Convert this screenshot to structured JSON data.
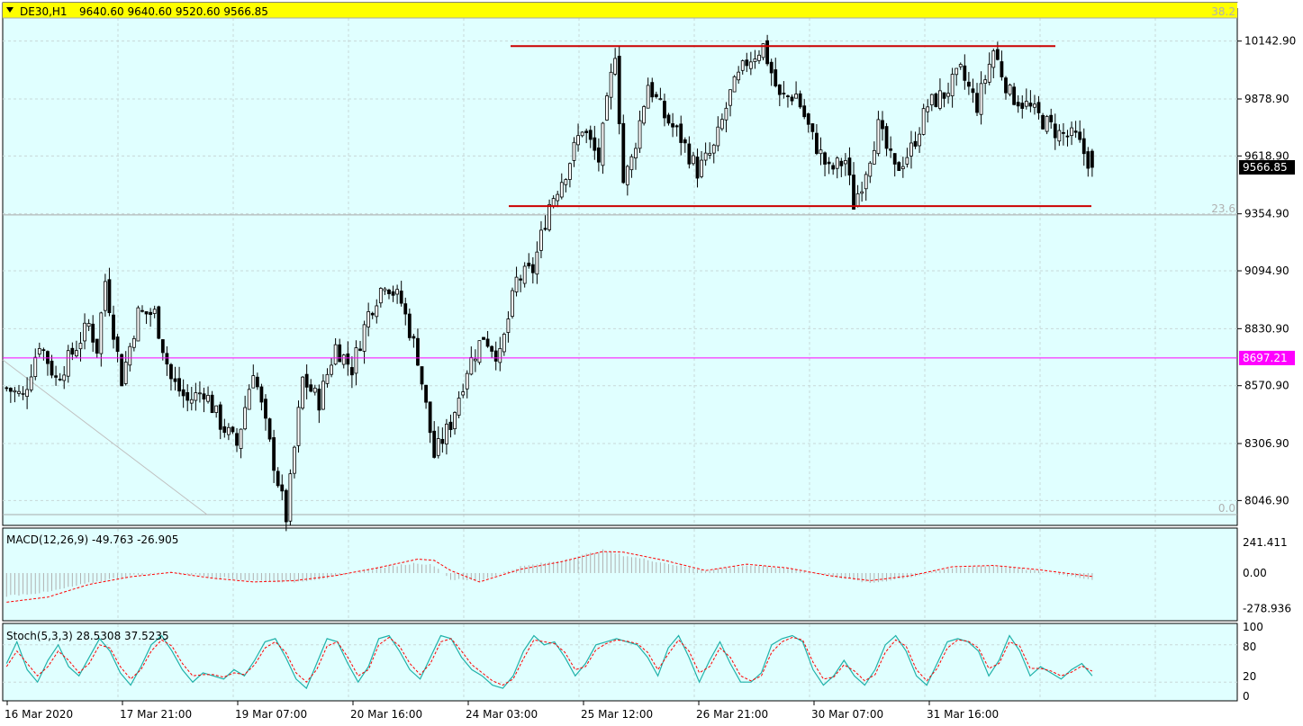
{
  "header": {
    "symbol": "DE30,H1",
    "ohlc": "9640.60 9640.60 9520.60 9566.85"
  },
  "price_axis_labels": [
    "10142.90",
    "9878.90",
    "9618.90",
    "9354.90",
    "9094.90",
    "8830.90",
    "8570.90",
    "8306.90",
    "8046.90"
  ],
  "current_price_tag": "9566.85",
  "horizontal_line_tag": "8697.21",
  "fib_labels": [
    "38.2",
    "23.6",
    "0.0"
  ],
  "macd": {
    "label": "MACD(12,26,9) -49.763 -26.905",
    "axis_labels": [
      "241.411",
      "0.00",
      "-278.936"
    ]
  },
  "stoch": {
    "label": "Stoch(5,3,3) 28.5308 37.5235",
    "axis_labels": [
      "100",
      "80",
      "20",
      "0"
    ]
  },
  "time_labels": [
    "16 Mar 2020",
    "17 Mar 21:00",
    "19 Mar 07:00",
    "20 Mar 16:00",
    "24 Mar 03:00",
    "25 Mar 12:00",
    "26 Mar 21:00",
    "30 Mar 07:00",
    "31 Mar 16:00"
  ],
  "colors": {
    "background": "#e0ffff",
    "header_bar": "#ffff00",
    "resistance_support": "#cc0000",
    "horizontal_line": "#ff00ff",
    "macd_signal": "#ff0000",
    "stoch_main": "#20b2aa",
    "stoch_signal": "#ff0000"
  },
  "chart_data": {
    "type": "candlestick",
    "symbol": "DE30",
    "timeframe": "H1",
    "ylim": [
      7950,
      10240
    ],
    "resistance_level": 10120,
    "support_level": 9390,
    "horizontal_level": 8697.21,
    "fib_levels": [
      {
        "label": "38.2",
        "price": 10240
      },
      {
        "label": "23.6",
        "price": 9350
      },
      {
        "label": "0.0",
        "price": 7950
      }
    ],
    "close_path": [
      [
        0,
        8560
      ],
      [
        4,
        8520
      ],
      [
        8,
        8770
      ],
      [
        12,
        8600
      ],
      [
        16,
        8720
      ],
      [
        20,
        8850
      ],
      [
        22,
        8740
      ],
      [
        24,
        9050
      ],
      [
        28,
        8600
      ],
      [
        32,
        8900
      ],
      [
        36,
        8900
      ],
      [
        40,
        8600
      ],
      [
        44,
        8500
      ],
      [
        48,
        8550
      ],
      [
        52,
        8400
      ],
      [
        56,
        8300
      ],
      [
        60,
        8650
      ],
      [
        64,
        8300
      ],
      [
        68,
        7970
      ],
      [
        72,
        8600
      ],
      [
        76,
        8500
      ],
      [
        80,
        8750
      ],
      [
        84,
        8650
      ],
      [
        88,
        8900
      ],
      [
        92,
        9050
      ],
      [
        96,
        8950
      ],
      [
        100,
        8700
      ],
      [
        104,
        8250
      ],
      [
        108,
        8400
      ],
      [
        112,
        8650
      ],
      [
        116,
        8800
      ],
      [
        120,
        8700
      ],
      [
        124,
        9050
      ],
      [
        128,
        9100
      ],
      [
        132,
        9400
      ],
      [
        136,
        9550
      ],
      [
        140,
        9750
      ],
      [
        144,
        9600
      ],
      [
        148,
        10100
      ],
      [
        150,
        9500
      ],
      [
        152,
        9600
      ],
      [
        156,
        9950
      ],
      [
        160,
        9800
      ],
      [
        164,
        9700
      ],
      [
        168,
        9550
      ],
      [
        172,
        9650
      ],
      [
        176,
        9900
      ],
      [
        180,
        10050
      ],
      [
        184,
        10120
      ],
      [
        188,
        9880
      ],
      [
        192,
        9900
      ],
      [
        196,
        9700
      ],
      [
        200,
        9550
      ],
      [
        204,
        9600
      ],
      [
        206,
        9400
      ],
      [
        208,
        9500
      ],
      [
        212,
        9750
      ],
      [
        216,
        9550
      ],
      [
        220,
        9650
      ],
      [
        224,
        9850
      ],
      [
        228,
        9900
      ],
      [
        232,
        10000
      ],
      [
        236,
        9850
      ],
      [
        240,
        10100
      ],
      [
        244,
        9900
      ],
      [
        248,
        9850
      ],
      [
        252,
        9780
      ],
      [
        256,
        9720
      ],
      [
        260,
        9700
      ],
      [
        264,
        9566.85
      ]
    ],
    "macd_hist_path": [
      [
        0,
        -180
      ],
      [
        10,
        -150
      ],
      [
        20,
        -80
      ],
      [
        30,
        -20
      ],
      [
        40,
        10
      ],
      [
        50,
        -30
      ],
      [
        60,
        -60
      ],
      [
        70,
        -70
      ],
      [
        80,
        -30
      ],
      [
        90,
        40
      ],
      [
        100,
        80
      ],
      [
        104,
        60
      ],
      [
        108,
        -50
      ],
      [
        115,
        -60
      ],
      [
        125,
        50
      ],
      [
        135,
        100
      ],
      [
        145,
        180
      ],
      [
        150,
        140
      ],
      [
        160,
        80
      ],
      [
        170,
        20
      ],
      [
        180,
        60
      ],
      [
        190,
        40
      ],
      [
        200,
        -20
      ],
      [
        210,
        -80
      ],
      [
        220,
        -30
      ],
      [
        230,
        40
      ],
      [
        240,
        60
      ],
      [
        250,
        20
      ],
      [
        264,
        -50
      ]
    ],
    "macd_signal_path": [
      [
        0,
        -230
      ],
      [
        10,
        -190
      ],
      [
        20,
        -90
      ],
      [
        30,
        -30
      ],
      [
        40,
        5
      ],
      [
        50,
        -40
      ],
      [
        60,
        -70
      ],
      [
        70,
        -60
      ],
      [
        80,
        -20
      ],
      [
        90,
        40
      ],
      [
        100,
        110
      ],
      [
        104,
        100
      ],
      [
        108,
        20
      ],
      [
        115,
        -70
      ],
      [
        125,
        30
      ],
      [
        135,
        90
      ],
      [
        145,
        170
      ],
      [
        150,
        165
      ],
      [
        160,
        100
      ],
      [
        170,
        20
      ],
      [
        180,
        70
      ],
      [
        190,
        40
      ],
      [
        200,
        -20
      ],
      [
        210,
        -60
      ],
      [
        220,
        -20
      ],
      [
        230,
        50
      ],
      [
        240,
        60
      ],
      [
        250,
        30
      ],
      [
        264,
        -27
      ]
    ],
    "stoch_main": [
      50,
      85,
      40,
      20,
      55,
      80,
      45,
      30,
      60,
      90,
      70,
      35,
      15,
      45,
      80,
      95,
      70,
      40,
      20,
      35,
      30,
      25,
      40,
      30,
      55,
      85,
      90,
      60,
      25,
      10,
      50,
      90,
      85,
      50,
      20,
      45,
      90,
      95,
      70,
      40,
      25,
      60,
      95,
      90,
      60,
      40,
      30,
      15,
      10,
      30,
      70,
      95,
      80,
      85,
      60,
      30,
      50,
      80,
      85,
      90,
      85,
      80,
      60,
      30,
      75,
      95,
      60,
      20,
      55,
      85,
      50,
      20,
      20,
      35,
      80,
      90,
      95,
      85,
      40,
      15,
      30,
      55,
      30,
      15,
      40,
      80,
      95,
      70,
      30,
      15,
      50,
      85,
      90,
      85,
      70,
      30,
      55,
      95,
      70,
      30,
      45,
      35,
      25,
      40,
      50,
      30
    ],
    "stoch_signal": [
      45,
      70,
      50,
      30,
      45,
      70,
      55,
      35,
      50,
      80,
      75,
      45,
      25,
      40,
      70,
      88,
      78,
      50,
      30,
      32,
      32,
      28,
      35,
      32,
      48,
      75,
      85,
      68,
      35,
      20,
      40,
      78,
      85,
      60,
      30,
      40,
      80,
      92,
      78,
      50,
      32,
      50,
      85,
      90,
      70,
      48,
      35,
      22,
      15,
      25,
      58,
      88,
      85,
      82,
      68,
      40,
      45,
      72,
      82,
      88,
      86,
      82,
      68,
      40,
      65,
      88,
      70,
      35,
      45,
      75,
      60,
      30,
      22,
      30,
      68,
      85,
      92,
      88,
      52,
      25,
      28,
      48,
      38,
      22,
      32,
      68,
      88,
      78,
      40,
      22,
      42,
      75,
      88,
      86,
      75,
      42,
      50,
      85,
      78,
      42,
      42,
      38,
      30,
      36,
      46,
      37.5
    ]
  }
}
